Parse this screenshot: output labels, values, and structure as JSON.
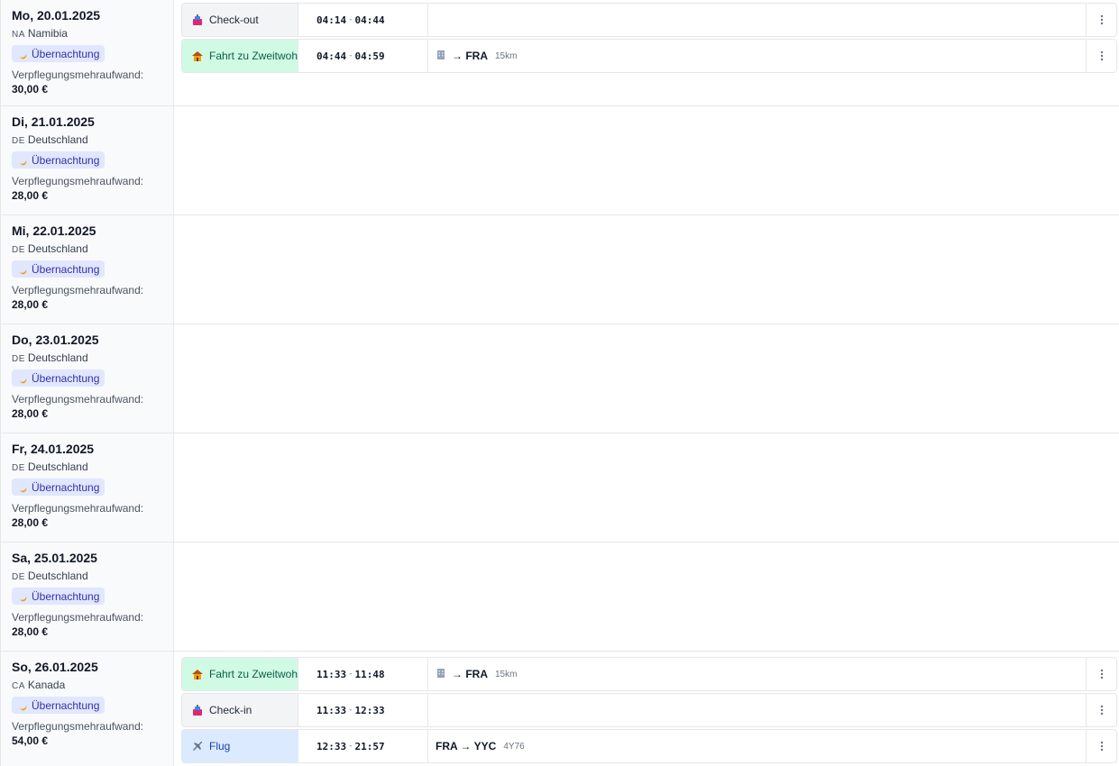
{
  "days": [
    {
      "date": "Mo, 20.01.2025",
      "cc": "NA",
      "country": "Namibia",
      "badge": "Übernachtung",
      "vm_label": "Verpflegungsmehraufwand:",
      "amount": "30,00 €"
    },
    {
      "date": "Di, 21.01.2025",
      "cc": "DE",
      "country": "Deutschland",
      "badge": "Übernachtung",
      "vm_label": "Verpflegungsmehraufwand:",
      "amount": "28,00 €"
    },
    {
      "date": "Mi, 22.01.2025",
      "cc": "DE",
      "country": "Deutschland",
      "badge": "Übernachtung",
      "vm_label": "Verpflegungsmehraufwand:",
      "amount": "28,00 €"
    },
    {
      "date": "Do, 23.01.2025",
      "cc": "DE",
      "country": "Deutschland",
      "badge": "Übernachtung",
      "vm_label": "Verpflegungsmehraufwand:",
      "amount": "28,00 €"
    },
    {
      "date": "Fr, 24.01.2025",
      "cc": "DE",
      "country": "Deutschland",
      "badge": "Übernachtung",
      "vm_label": "Verpflegungsmehraufwand:",
      "amount": "28,00 €"
    },
    {
      "date": "Sa, 25.01.2025",
      "cc": "DE",
      "country": "Deutschland",
      "badge": "Übernachtung",
      "vm_label": "Verpflegungsmehraufwand:",
      "amount": "28,00 €"
    },
    {
      "date": "So, 26.01.2025",
      "cc": "CA",
      "country": "Kanada",
      "badge": "Übernachtung",
      "vm_label": "Verpflegungsmehraufwand:",
      "amount": "54,00 €"
    }
  ],
  "events": [
    {
      "type": "Check-out",
      "start": "04:14",
      "end": "04:44",
      "route": "",
      "extra": "",
      "icon": "hotel-icon"
    },
    {
      "type": "Fahrt zu Zweitwohnung",
      "start": "04:44",
      "end": "04:59",
      "route": "→ FRA",
      "extra": "15km",
      "icon": "home-icon"
    },
    {
      "type": "Fahrt zu Zweitwohnung",
      "start": "11:33",
      "end": "11:48",
      "route": "→ FRA",
      "extra": "15km",
      "icon": "home-icon"
    },
    {
      "type": "Check-in",
      "start": "11:33",
      "end": "12:33",
      "route": "",
      "extra": "",
      "icon": "hotel-icon"
    },
    {
      "type": "Flug",
      "start": "12:33",
      "end": "21:57",
      "route": "FRA → YYC",
      "extra": "4Y76",
      "icon": "plane-icon"
    }
  ],
  "colors": {
    "badge_bg": "#e0e7ff",
    "fahrt_bg": "#d1fae5",
    "flug_bg": "#dbeafe",
    "checkio_bg": "#f3f4f6"
  }
}
